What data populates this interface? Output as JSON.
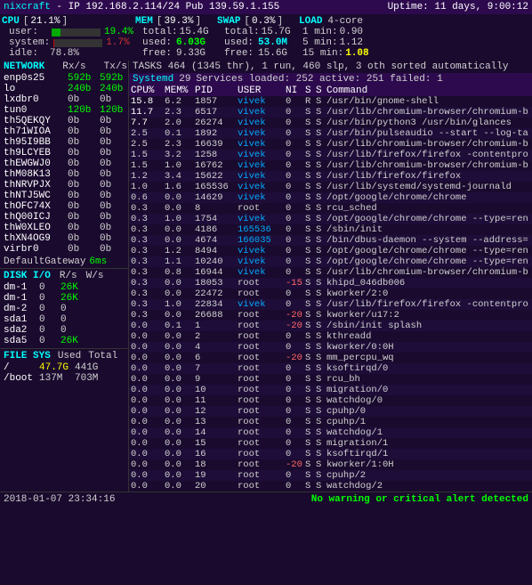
{
  "header": {
    "title": "nixcraft",
    "ip": "IP 192.168.2.114/24 Pub 139.59.1.155",
    "uptime": "Uptime: 11 days, 9:00:12"
  },
  "cpu": {
    "label": "CPU",
    "percent": "21.1%",
    "bar_pct": 21,
    "user_label": "user:",
    "user_pct": "19.4%",
    "user_bar": 19,
    "system_label": "system:",
    "system_pct": "1.7%",
    "system_bar": 2,
    "idle_label": "idle:",
    "idle_pct": "78.8%"
  },
  "mem": {
    "label": "MEM",
    "percent": "39.3%",
    "bar_pct": 39,
    "total_label": "total:",
    "total_val": "15.4G",
    "used_label": "used:",
    "used_val": "6.03G",
    "used_bar": 39,
    "free_label": "free:",
    "free_val": "9.33G"
  },
  "swap": {
    "label": "SWAP",
    "percent": "0.3%",
    "bar_pct": 1,
    "total_label": "total:",
    "total_val": "15.7G",
    "used_label": "used:",
    "used_val": "53.0M",
    "used_bar": 1,
    "free_label": "free:",
    "free_val": "15.6G"
  },
  "load": {
    "label": "LOAD",
    "cores": "4-core",
    "min1_label": "1 min:",
    "min1_val": "0.90",
    "min5_label": "5 min:",
    "min5_val": "1.12",
    "min15_label": "15 min:",
    "min15_val": "1.08"
  },
  "mem_row_label": "MEM [ 39.3%]",
  "swap_row_label": "SWAP [  0.3%]",
  "network": {
    "header": "NETWORK",
    "rx_col": "Rx/s",
    "tx_col": "Tx/s",
    "interfaces": [
      {
        "name": "enp0s25",
        "rx": "592b",
        "tx": "592b"
      },
      {
        "name": "lo",
        "rx": "240b",
        "tx": "240b"
      },
      {
        "name": "lxdbr0",
        "rx": "0b",
        "tx": "0b"
      },
      {
        "name": "tun0",
        "rx": "120b",
        "tx": "120b"
      },
      {
        "name": "th5QEKQY",
        "rx": "0b",
        "tx": "0b"
      },
      {
        "name": "th71WIOA",
        "rx": "0b",
        "tx": "0b"
      },
      {
        "name": "th95I9BB",
        "rx": "0b",
        "tx": "0b"
      },
      {
        "name": "th9LCYEB",
        "rx": "0b",
        "tx": "0b"
      },
      {
        "name": "thEWGWJ0",
        "rx": "0b",
        "tx": "0b"
      },
      {
        "name": "thM08K13",
        "rx": "0b",
        "tx": "0b"
      },
      {
        "name": "thNRVPJX",
        "rx": "0b",
        "tx": "0b"
      },
      {
        "name": "thNTJ5WC",
        "rx": "0b",
        "tx": "0b"
      },
      {
        "name": "thOFC74X",
        "rx": "0b",
        "tx": "0b"
      },
      {
        "name": "thQ00ICJ",
        "rx": "0b",
        "tx": "0b"
      },
      {
        "name": "thW0XLEO",
        "rx": "0b",
        "tx": "0b"
      },
      {
        "name": "thXN4OG9",
        "rx": "0b",
        "tx": "0b"
      },
      {
        "name": "virbr0",
        "rx": "0b",
        "tx": "0b"
      }
    ],
    "gateway_label": "DefaultGateway",
    "gateway_val": "6ms"
  },
  "tasks": {
    "text": "TASKS 464 (1345 thr), 1 run, 460 slp, 3 oth sorted automatically"
  },
  "systemd": {
    "name": "Systemd",
    "pid": "29",
    "services_text": "Services loaded: 252 active: 251 failed: 1"
  },
  "process_header": {
    "cpu": "CPU%",
    "mem": "MEM%",
    "pid": "PID",
    "user": "USER",
    "ni": "NI",
    "s": "S",
    "s2": "S",
    "command": "Command"
  },
  "processes": [
    {
      "cpu": "15.8",
      "mem": "6.2",
      "pid": "1857",
      "user": "vivek",
      "ni": "0",
      "s1": "R",
      "s2": "S",
      "cmd": "/usr/bin/gnome-shell"
    },
    {
      "cpu": "11.7",
      "mem": "2.3",
      "pid": "6517",
      "user": "vivek",
      "ni": "0",
      "s1": "S",
      "s2": "S",
      "cmd": "/usr/lib/chromium-browser/chromium-b"
    },
    {
      "cpu": "7.7",
      "mem": "2.0",
      "pid": "26274",
      "user": "vivek",
      "ni": "0",
      "s1": "S",
      "s2": "S",
      "cmd": "/usr/bin/python3 /usr/bin/glances"
    },
    {
      "cpu": "2.5",
      "mem": "0.1",
      "pid": "1892",
      "user": "vivek",
      "ni": "0",
      "s1": "S",
      "s2": "S",
      "cmd": "/usr/bin/pulseaudio --start --log-ta"
    },
    {
      "cpu": "2.5",
      "mem": "2.3",
      "pid": "16639",
      "user": "vivek",
      "ni": "0",
      "s1": "S",
      "s2": "S",
      "cmd": "/usr/lib/chromium-browser/chromium-b"
    },
    {
      "cpu": "1.5",
      "mem": "3.2",
      "pid": "1258",
      "user": "vivek",
      "ni": "0",
      "s1": "S",
      "s2": "S",
      "cmd": "/usr/lib/firefox/firefox -contentpro"
    },
    {
      "cpu": "1.5",
      "mem": "1.0",
      "pid": "16762",
      "user": "vivek",
      "ni": "0",
      "s1": "S",
      "s2": "S",
      "cmd": "/usr/lib/chromium-browser/chromium-b"
    },
    {
      "cpu": "1.2",
      "mem": "3.4",
      "pid": "15622",
      "user": "vivek",
      "ni": "0",
      "s1": "S",
      "s2": "S",
      "cmd": "/usr/lib/firefox/firefox"
    },
    {
      "cpu": "1.0",
      "mem": "1.6",
      "pid": "165536",
      "user": "vivek",
      "ni": "0",
      "s1": "S",
      "s2": "S",
      "cmd": "/usr/lib/systemd/systemd-journald"
    },
    {
      "cpu": "0.6",
      "mem": "0.0",
      "pid": "14629",
      "user": "vivek",
      "ni": "0",
      "s1": "S",
      "s2": "S",
      "cmd": "/opt/google/chrome/chrome"
    },
    {
      "cpu": "0.3",
      "mem": "0.0",
      "pid": "8",
      "user": "root",
      "ni": "0",
      "s1": "S",
      "s2": "S",
      "cmd": "rcu_sched"
    },
    {
      "cpu": "0.3",
      "mem": "1.0",
      "pid": "1754",
      "user": "vivek",
      "ni": "0",
      "s1": "S",
      "s2": "S",
      "cmd": "/opt/google/chrome/chrome --type=ren"
    },
    {
      "cpu": "0.3",
      "mem": "0.0",
      "pid": "4186",
      "user": "165536",
      "ni": "0",
      "s1": "S",
      "s2": "S",
      "cmd": "/sbin/init"
    },
    {
      "cpu": "0.3",
      "mem": "0.0",
      "pid": "4674",
      "user": "166035",
      "ni": "0",
      "s1": "S",
      "s2": "S",
      "cmd": "/bin/dbus-daemon --system --address="
    },
    {
      "cpu": "0.3",
      "mem": "1.2",
      "pid": "8494",
      "user": "vivek",
      "ni": "0",
      "s1": "S",
      "s2": "S",
      "cmd": "/opt/google/chrome/chrome --type=ren"
    },
    {
      "cpu": "0.3",
      "mem": "1.1",
      "pid": "10240",
      "user": "vivek",
      "ni": "0",
      "s1": "S",
      "s2": "S",
      "cmd": "/opt/google/chrome/chrome --type=ren"
    },
    {
      "cpu": "0.3",
      "mem": "0.8",
      "pid": "16944",
      "user": "vivek",
      "ni": "0",
      "s1": "S",
      "s2": "S",
      "cmd": "/usr/lib/chromium-browser/chromium-b"
    },
    {
      "cpu": "0.3",
      "mem": "0.0",
      "pid": "18053",
      "user": "root",
      "ni": "-15",
      "s1": "S",
      "s2": "S",
      "cmd": "khipd_046db006"
    },
    {
      "cpu": "0.3",
      "mem": "0.0",
      "pid": "22472",
      "user": "root",
      "ni": "0",
      "s1": "S",
      "s2": "S",
      "cmd": "kworker/2:0"
    },
    {
      "cpu": "0.3",
      "mem": "1.0",
      "pid": "22834",
      "user": "vivek",
      "ni": "0",
      "s1": "S",
      "s2": "S",
      "cmd": "/usr/lib/firefox/firefox -contentpro"
    },
    {
      "cpu": "0.3",
      "mem": "0.0",
      "pid": "26688",
      "user": "root",
      "ni": "-20",
      "s1": "S",
      "s2": "S",
      "cmd": "kworker/u17:2"
    },
    {
      "cpu": "0.0",
      "mem": "0.1",
      "pid": "1",
      "user": "root",
      "ni": "-20",
      "s1": "S",
      "s2": "S",
      "cmd": "/sbin/init splash"
    },
    {
      "cpu": "0.0",
      "mem": "0.0",
      "pid": "2",
      "user": "root",
      "ni": "0",
      "s1": "S",
      "s2": "S",
      "cmd": "kthreadd"
    },
    {
      "cpu": "0.0",
      "mem": "0.0",
      "pid": "4",
      "user": "root",
      "ni": "0",
      "s1": "S",
      "s2": "S",
      "cmd": "kworker/0:0H"
    },
    {
      "cpu": "0.0",
      "mem": "0.0",
      "pid": "6",
      "user": "root",
      "ni": "-20",
      "s1": "S",
      "s2": "S",
      "cmd": "mm_percpu_wq"
    },
    {
      "cpu": "0.0",
      "mem": "0.0",
      "pid": "7",
      "user": "root",
      "ni": "0",
      "s1": "S",
      "s2": "S",
      "cmd": "ksoftirqd/0"
    },
    {
      "cpu": "0.0",
      "mem": "0.0",
      "pid": "9",
      "user": "root",
      "ni": "0",
      "s1": "S",
      "s2": "S",
      "cmd": "rcu_bh"
    },
    {
      "cpu": "0.0",
      "mem": "0.0",
      "pid": "10",
      "user": "root",
      "ni": "0",
      "s1": "S",
      "s2": "S",
      "cmd": "migration/0"
    },
    {
      "cpu": "0.0",
      "mem": "0.0",
      "pid": "11",
      "user": "root",
      "ni": "0",
      "s1": "S",
      "s2": "S",
      "cmd": "watchdog/0"
    },
    {
      "cpu": "0.0",
      "mem": "0.0",
      "pid": "12",
      "user": "root",
      "ni": "0",
      "s1": "S",
      "s2": "S",
      "cmd": "cpuhp/0"
    },
    {
      "cpu": "0.0",
      "mem": "0.0",
      "pid": "13",
      "user": "root",
      "ni": "0",
      "s1": "S",
      "s2": "S",
      "cmd": "cpuhp/1"
    },
    {
      "cpu": "0.0",
      "mem": "0.0",
      "pid": "14",
      "user": "root",
      "ni": "0",
      "s1": "S",
      "s2": "S",
      "cmd": "watchdog/1"
    },
    {
      "cpu": "0.0",
      "mem": "0.0",
      "pid": "15",
      "user": "root",
      "ni": "0",
      "s1": "S",
      "s2": "S",
      "cmd": "migration/1"
    },
    {
      "cpu": "0.0",
      "mem": "0.0",
      "pid": "16",
      "user": "root",
      "ni": "0",
      "s1": "S",
      "s2": "S",
      "cmd": "ksoftirqd/1"
    },
    {
      "cpu": "0.0",
      "mem": "0.0",
      "pid": "18",
      "user": "root",
      "ni": "-20",
      "s1": "S",
      "s2": "S",
      "cmd": "kworker/1:0H"
    },
    {
      "cpu": "0.0",
      "mem": "0.0",
      "pid": "19",
      "user": "root",
      "ni": "0",
      "s1": "S",
      "s2": "S",
      "cmd": "cpuhp/2"
    },
    {
      "cpu": "0.0",
      "mem": "0.0",
      "pid": "20",
      "user": "root",
      "ni": "0",
      "s1": "S",
      "s2": "S",
      "cmd": "watchdog/2"
    }
  ],
  "disk": {
    "header": "DISK I/O",
    "r_col": "R/s",
    "w_col": "W/s",
    "disks": [
      {
        "name": "dm-1",
        "r": "0",
        "w": "26K"
      },
      {
        "name": "dm-1",
        "r": "0",
        "w": "26K"
      },
      {
        "name": "dm-2",
        "r": "0",
        "w": "0"
      },
      {
        "name": "sda1",
        "r": "0",
        "w": "0"
      },
      {
        "name": "sda2",
        "r": "0",
        "w": "0"
      },
      {
        "name": "sda5",
        "r": "0",
        "w": "26K"
      }
    ]
  },
  "filesystem": {
    "header": "FILE SYS",
    "used_col": "Used",
    "total_col": "Total",
    "mounts": [
      {
        "name": "/",
        "used": "47.7G",
        "total": "441G"
      },
      {
        "name": "/boot",
        "used": "137M",
        "total": "703M"
      }
    ]
  },
  "footer": {
    "timestamp": "2018-01-07 23:34:16",
    "alert": "No warning or critical alert detected"
  }
}
